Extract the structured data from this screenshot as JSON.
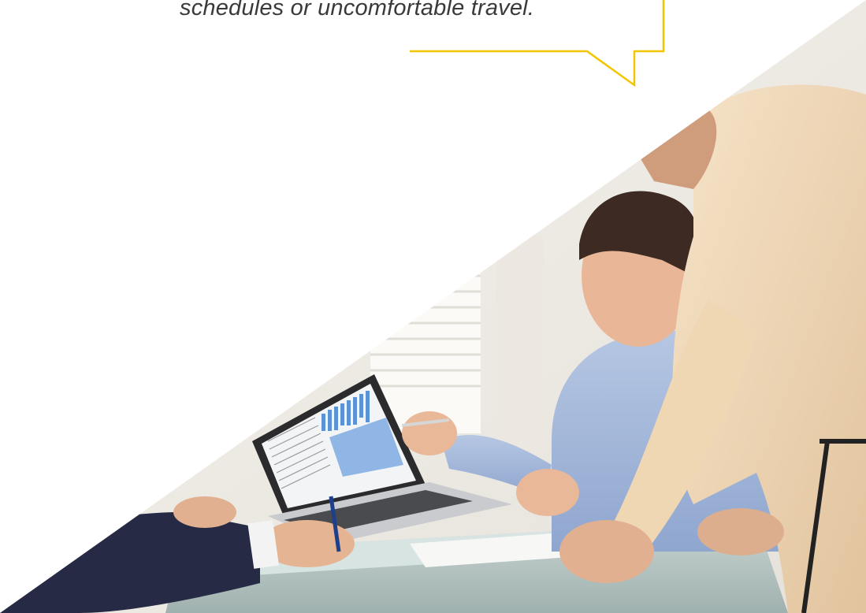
{
  "testimonial": {
    "quote_line": "schedules or uncomfortable travel."
  },
  "colors": {
    "accent": "#f2c500",
    "background": "#ffffff",
    "quote_text": "#3a3a3a"
  },
  "photo": {
    "subject": "business-meeting-photo"
  }
}
